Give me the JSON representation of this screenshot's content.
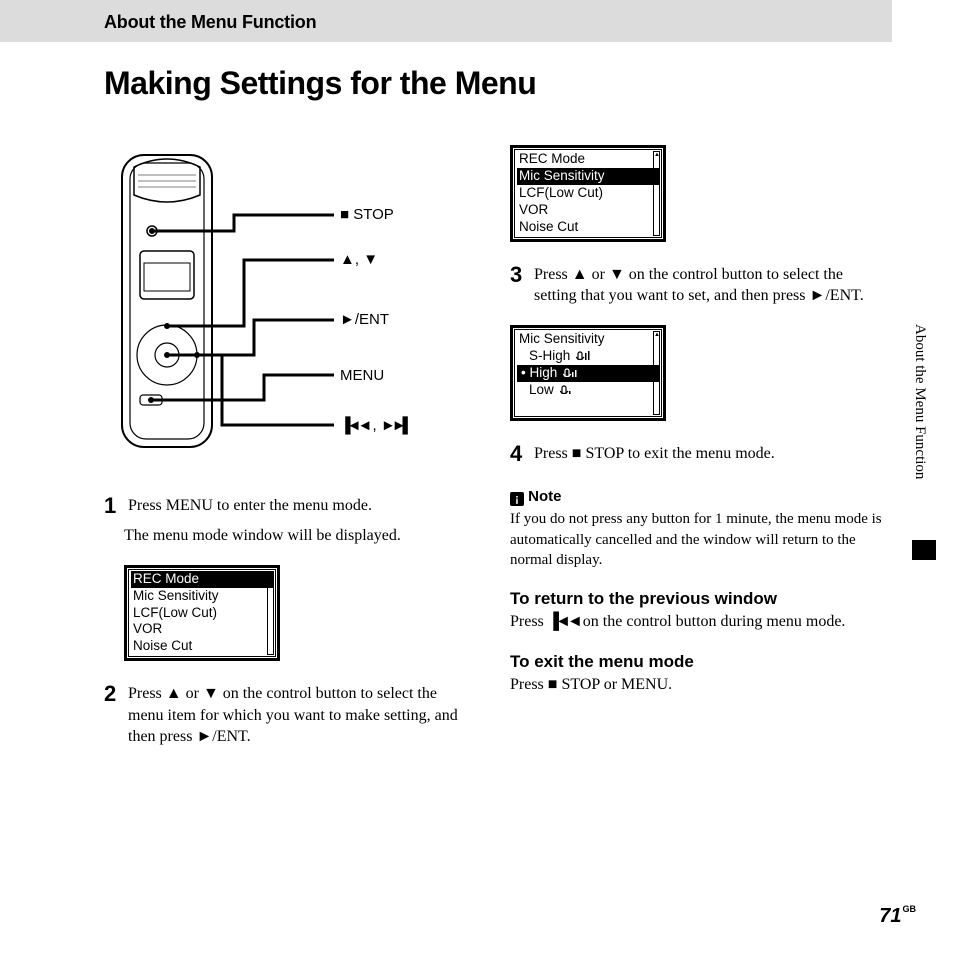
{
  "header": {
    "section": "About the Menu Function"
  },
  "title": "Making Settings for the Menu",
  "side_tab": "About the Menu Function",
  "callouts": {
    "stop": "STOP",
    "updown": ",",
    "ent": "/ENT",
    "menu": "MENU",
    "prevnext": ","
  },
  "steps": {
    "1": {
      "num": "1",
      "text": "Press MENU to enter the menu mode.",
      "sub": "The menu mode window will be displayed."
    },
    "2": {
      "num": "2",
      "text_a": "Press ",
      "text_b": " or ",
      "text_c": " on the control button to select the menu item for which you want to make setting, and then press ",
      "text_d": "/ENT."
    },
    "3": {
      "num": "3",
      "text_a": "Press ",
      "text_b": " or ",
      "text_c": " on the control button to select the setting that you want to set, and then press ",
      "text_d": "/ENT."
    },
    "4": {
      "num": "4",
      "text_a": "Press ",
      "text_b": " STOP to exit the menu mode."
    }
  },
  "screens": {
    "menu1": {
      "rows": [
        "REC Mode",
        "Mic Sensitivity",
        "LCF(Low Cut)",
        "VOR",
        "Noise Cut"
      ],
      "selected": 0
    },
    "menu2": {
      "rows": [
        "REC Mode",
        "Mic Sensitivity",
        "LCF(Low Cut)",
        "VOR",
        "Noise Cut"
      ],
      "selected": 1
    },
    "menu3": {
      "title": "Mic Sensitivity",
      "rows": [
        "S-High",
        "High",
        "Low"
      ],
      "selected": 1
    }
  },
  "note": {
    "head": "Note",
    "body": "If you do not press any button for 1 minute, the menu mode is automatically cancelled and the window will return to the normal display."
  },
  "return": {
    "head": "To return to the previous window",
    "body_a": "Press ",
    "body_b": " on the control button during menu mode."
  },
  "exit": {
    "head": "To exit the menu mode",
    "body_a": "Press ",
    "body_b": " STOP or MENU."
  },
  "page": {
    "num": "71",
    "region": "GB"
  }
}
